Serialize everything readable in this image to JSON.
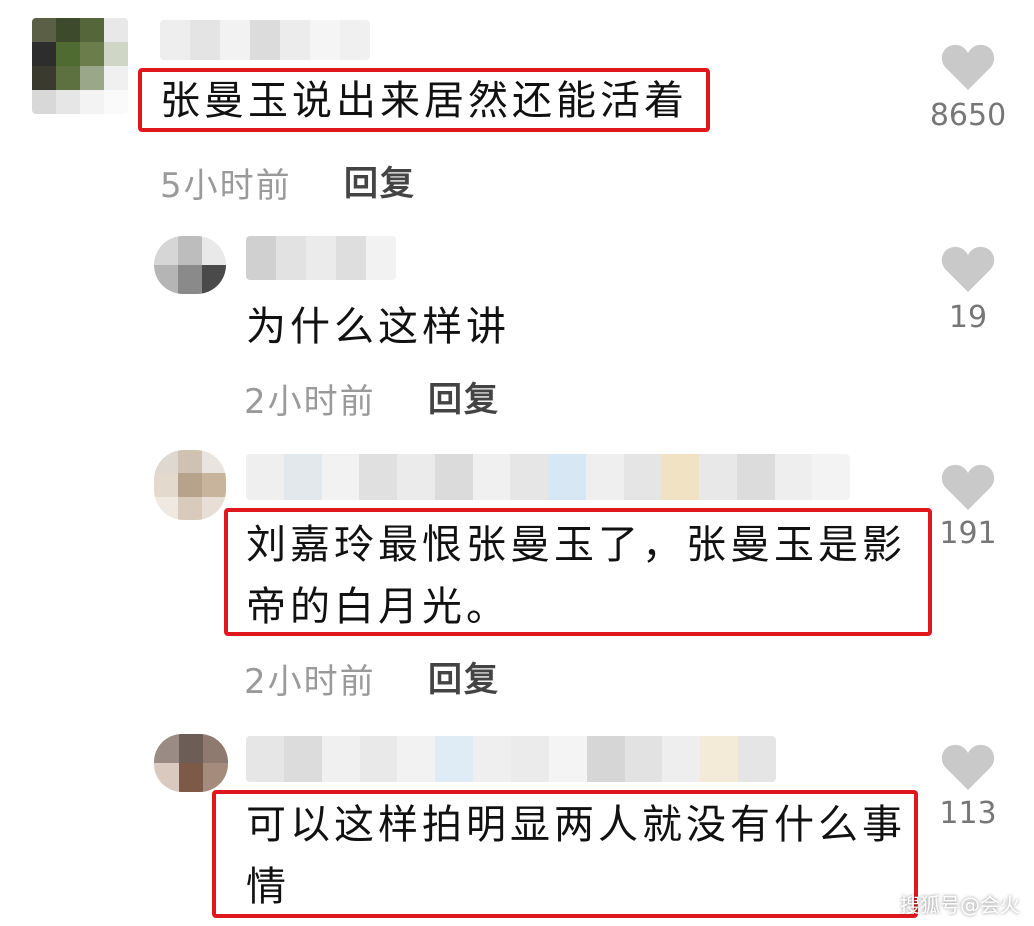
{
  "colors": {
    "highlight": "#e0181e",
    "heart": "#c9c9c9",
    "time": "#9a9a9a"
  },
  "comments": [
    {
      "text": "张曼玉说出来居然还能活着",
      "time": "5小时前",
      "reply": "回复",
      "likes": "8650",
      "highlighted": true
    },
    {
      "text": "为什么这样讲",
      "time": "2小时前",
      "reply": "回复",
      "likes": "19",
      "highlighted": false
    },
    {
      "text_line1": "刘嘉玲最恨张曼玉了，张曼玉是影",
      "text_line2": "帝的白月光。",
      "time": "2小时前",
      "reply": "回复",
      "likes": "191",
      "highlighted": true
    },
    {
      "text_line1": "可以这样拍明显两人就没有什么事",
      "text_line2": "情",
      "likes": "113",
      "highlighted": true
    }
  ],
  "watermark": "搜狐号@会火",
  "icons": {
    "like": "heart-icon"
  }
}
